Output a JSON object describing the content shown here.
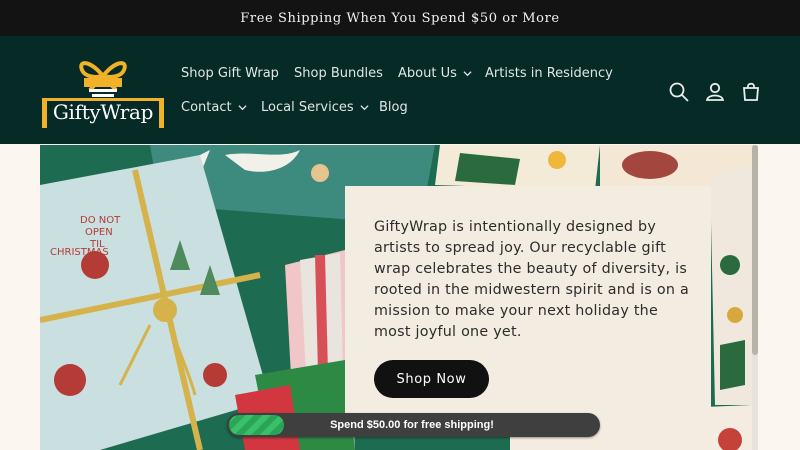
{
  "announcement": "Free Shipping When You Spend $50 or More",
  "brand": {
    "name": "GiftyWrap",
    "colors": {
      "header_bg": "#062a26",
      "gold": "#f1b22a",
      "announcement_bg": "#131313"
    }
  },
  "nav": {
    "items": [
      {
        "label": "Shop Gift Wrap",
        "dropdown": false
      },
      {
        "label": "Shop Bundles",
        "dropdown": false
      },
      {
        "label": "About Us",
        "dropdown": true
      },
      {
        "label": "Artists in Residency",
        "dropdown": false
      },
      {
        "label": "Contact",
        "dropdown": true
      },
      {
        "label": "Local Services",
        "dropdown": true
      },
      {
        "label": "Blog",
        "dropdown": false
      }
    ]
  },
  "header_icons": [
    "search-icon",
    "account-icon",
    "cart-icon"
  ],
  "hero": {
    "text": "GiftyWrap is intentionally designed by artists to spread joy. Our recyclable gift wrap celebrates the beauty of diversity, is rooted in the midwestern spirit and is on a mission to make your next holiday the most joyful one yet.",
    "button_label": "Shop Now",
    "image_text": {
      "tag1": "DO NOT",
      "tag2": "OPEN",
      "tag3": "TIL",
      "tag4": "CHRISTMAS"
    }
  },
  "shipping_bar": {
    "text": "Spend $50.00 for free shipping!",
    "progress": 0.15
  }
}
